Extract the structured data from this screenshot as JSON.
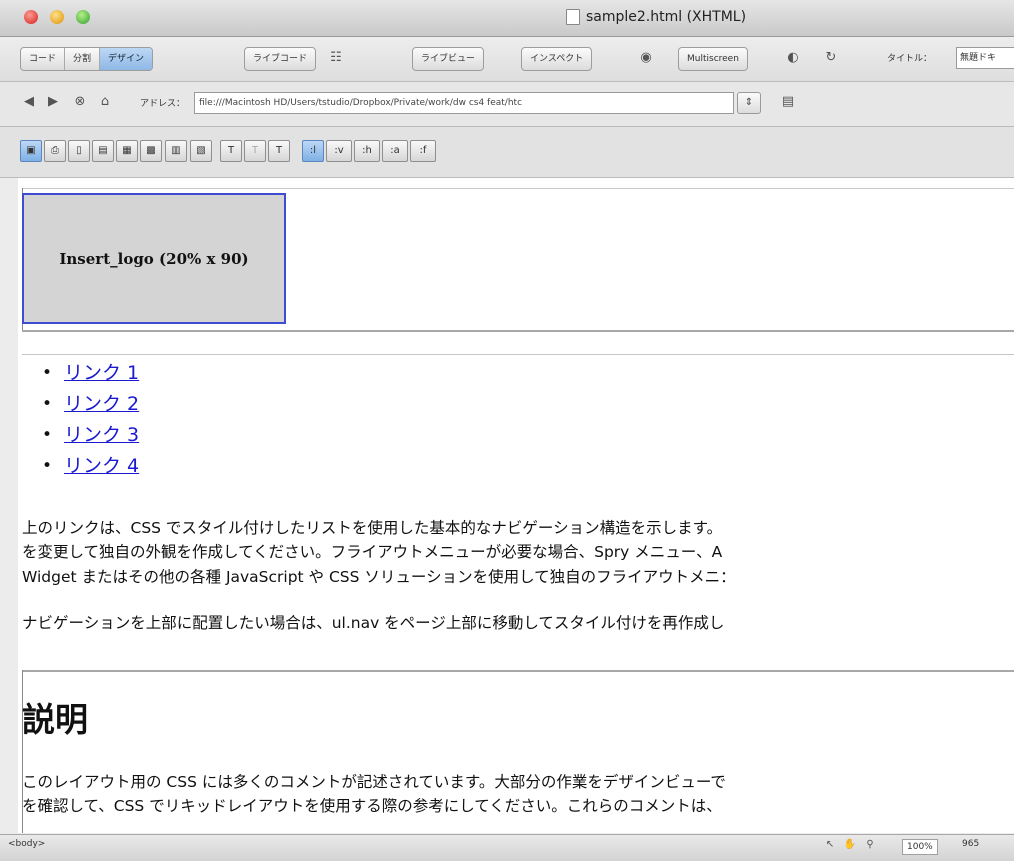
{
  "window": {
    "title": "sample2.html (XHTML)"
  },
  "toolbar": {
    "view_buttons": [
      "コード",
      "分割",
      "デザイン"
    ],
    "live_code": "ライブコード",
    "live_view": "ライブビュー",
    "inspect": "インスペクト",
    "multiscreen": "Multiscreen",
    "title_label": "タイトル：",
    "title_value": "無題ドキ"
  },
  "addressbar": {
    "label": "アドレス：",
    "url": "file:///Macintosh HD/Users/tstudio/Dropbox/Private/work/dw cs4 feat/htc"
  },
  "formatbar": {
    "pseudo_buttons": [
      ":l",
      ":v",
      ":h",
      ":a",
      ":f"
    ],
    "text_buttons": [
      "T",
      "T",
      "T"
    ]
  },
  "content": {
    "logo_placeholder": "Insert_logo (20% x 90)",
    "nav_links": [
      "リンク 1",
      "リンク 2",
      "リンク 3",
      "リンク 4"
    ],
    "paragraph1": [
      "上のリンクは、CSS でスタイル付けしたリストを使用した基本的なナビゲーション構造を示します。",
      "を変更して独自の外観を作成してください。フライアウトメニューが必要な場合、Spry メニュー、A",
      "Widget またはその他の各種 JavaScript や CSS ソリューションを使用して独自のフライアウトメニ："
    ],
    "paragraph2": "ナビゲーションを上部に配置したい場合は、ul.nav をページ上部に移動してスタイル付けを再作成し",
    "heading": "説明",
    "paragraph3": [
      "このレイアウト用の CSS には多くのコメントが記述されています。大部分の作業をデザインビューで",
      "を確認して、CSS でリキッドレイアウトを使用する際の参考にしてください。これらのコメントは、"
    ]
  },
  "statusbar": {
    "tag_selector": "<body>",
    "zoom": "100%",
    "width": "965"
  }
}
